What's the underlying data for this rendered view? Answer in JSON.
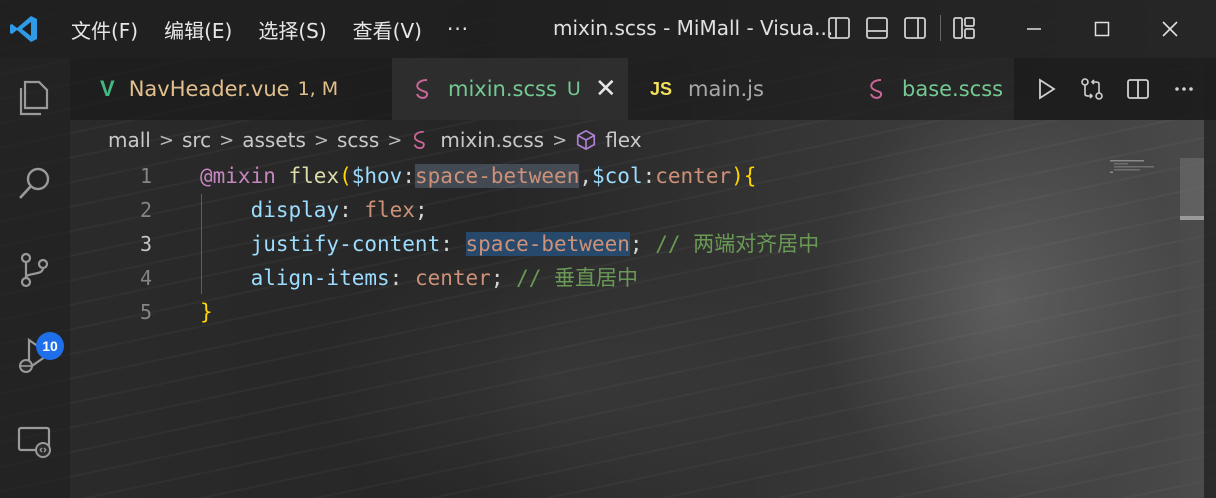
{
  "window": {
    "title": "mixin.scss - MiMall - Visua...",
    "icons": [
      "vscode-logo-icon",
      "toggle-primary-sidebar-icon",
      "toggle-panel-icon",
      "toggle-secondary-sidebar-icon",
      "customize-layout-icon",
      "minimize-icon",
      "maximize-icon",
      "close-icon"
    ]
  },
  "menu": {
    "items": [
      "文件(F)",
      "编辑(E)",
      "选择(S)",
      "查看(V)"
    ],
    "more": "···"
  },
  "activity_bar": {
    "items": [
      "explorer-icon",
      "search-icon",
      "source-control-icon",
      "run-debug-icon",
      "remote-explorer-icon"
    ],
    "source_control_badge": "10"
  },
  "tabs": [
    {
      "icon": "V",
      "label": "NavHeader.vue",
      "status": "1, M",
      "active": false
    },
    {
      "icon": "sass-icon",
      "label": "mixin.scss",
      "status": "U",
      "active": true,
      "close": "✕"
    },
    {
      "icon": "JS",
      "label": "main.js",
      "status": "",
      "active": false
    },
    {
      "icon": "sass-icon",
      "label": "base.scss",
      "status": "",
      "active": false
    }
  ],
  "breadcrumb": {
    "segments": [
      "mall",
      "src",
      "assets",
      "scss",
      "mixin.scss",
      "flex"
    ],
    "separator": ">"
  },
  "editor": {
    "lines": [
      {
        "number": "1",
        "tokens": [
          {
            "t": "@mixin",
            "c": "kw"
          },
          {
            "t": " ",
            "c": "punc"
          },
          {
            "t": "flex",
            "c": "fn"
          },
          {
            "t": "(",
            "c": "brace"
          },
          {
            "t": "$hov",
            "c": "var"
          },
          {
            "t": ":",
            "c": "punc"
          },
          {
            "t": "space-between",
            "c": "val hl"
          },
          {
            "t": ",",
            "c": "punc"
          },
          {
            "t": "$col",
            "c": "var"
          },
          {
            "t": ":",
            "c": "punc"
          },
          {
            "t": "center",
            "c": "val"
          },
          {
            "t": ")",
            "c": "brace"
          },
          {
            "t": "{",
            "c": "brace"
          }
        ]
      },
      {
        "number": "2",
        "tokens": [
          {
            "t": "    display",
            "c": "prop"
          },
          {
            "t": ": ",
            "c": "punc"
          },
          {
            "t": "flex",
            "c": "val"
          },
          {
            "t": ";",
            "c": "punc"
          }
        ]
      },
      {
        "number": "3",
        "current": true,
        "tokens": [
          {
            "t": "    justify-content",
            "c": "prop"
          },
          {
            "t": ": ",
            "c": "punc"
          },
          {
            "t": "space-between",
            "c": "val hl-sel"
          },
          {
            "t": "; ",
            "c": "punc"
          },
          {
            "t": "// 两端对齐居中",
            "c": "cmt"
          }
        ]
      },
      {
        "number": "4",
        "tokens": [
          {
            "t": "    align-items",
            "c": "prop"
          },
          {
            "t": ": ",
            "c": "punc"
          },
          {
            "t": "center",
            "c": "val"
          },
          {
            "t": "; ",
            "c": "punc"
          },
          {
            "t": "// 垂直居中",
            "c": "cmt"
          }
        ]
      },
      {
        "number": "5",
        "tokens": [
          {
            "t": "}",
            "c": "brace"
          }
        ]
      }
    ]
  },
  "colors": {
    "accent": "#1f6feb",
    "vue": "#42b883",
    "sass": "#cd6799",
    "js": "#f1e05a",
    "modified": "#e2c08d",
    "untracked": "#73c991"
  }
}
